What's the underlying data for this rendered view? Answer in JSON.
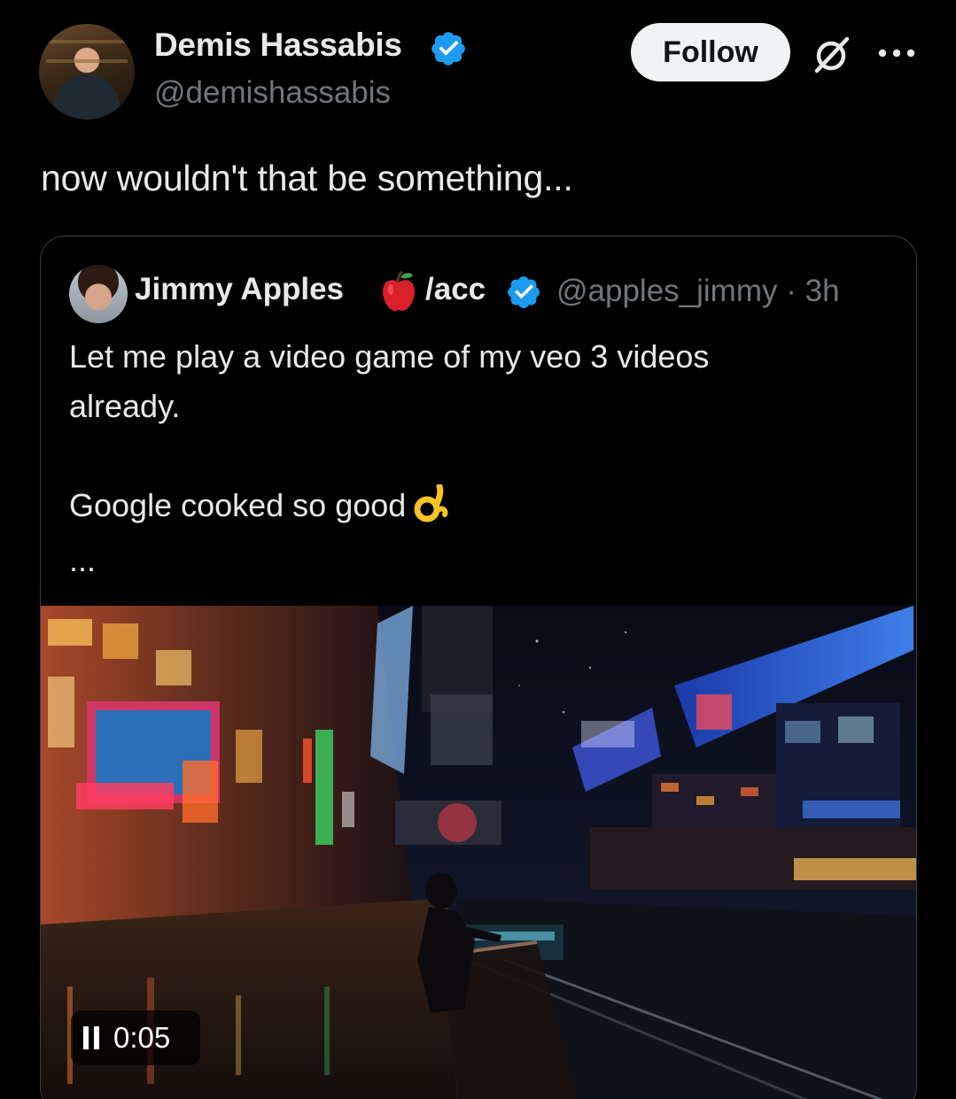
{
  "author": {
    "name": "Demis Hassabis",
    "handle": "@demishassabis",
    "verified": true
  },
  "actions": {
    "follow_label": "Follow",
    "grok_icon": "grok-icon",
    "more_icon": "more-icon"
  },
  "post": {
    "text": "now wouldn't that be something..."
  },
  "quoted": {
    "name": "Jimmy Apples",
    "name_suffix": "/acc",
    "emoji": "apple",
    "handle_time": "@apples_jimmy · 3h",
    "lines": [
      "Let me play a video game of my veo 3 videos",
      "already.",
      "",
      "Google cooked so good",
      "..."
    ],
    "ok_emoji": "ok-hand",
    "video": {
      "time": "0:05",
      "state": "playing"
    }
  },
  "colors": {
    "background": "#000000",
    "text": "#e7e9ea",
    "secondary": "#71767b",
    "verified": "#1d9bf0",
    "border": "#3a3f44"
  }
}
